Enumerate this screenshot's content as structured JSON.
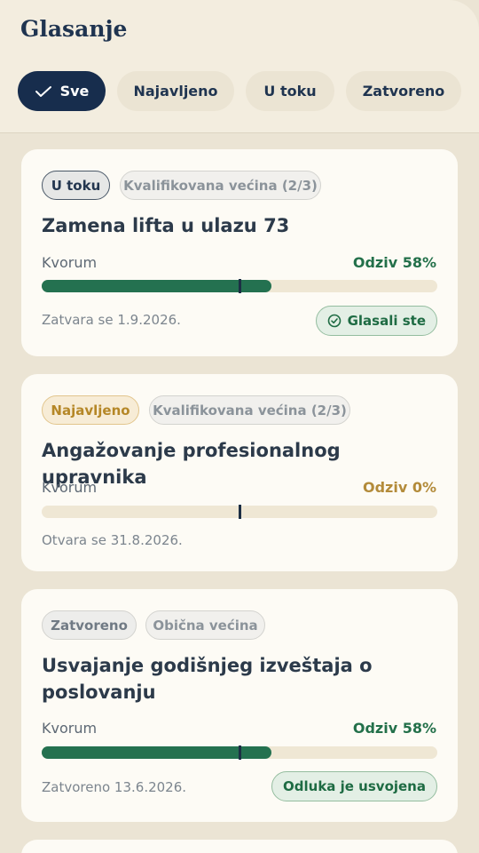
{
  "header": {
    "title": "Glasanje"
  },
  "filters": {
    "tabs": [
      {
        "label": "Sve",
        "active": true
      },
      {
        "label": "Najavljeno",
        "active": false
      },
      {
        "label": "U toku",
        "active": false
      },
      {
        "label": "Zatvoreno",
        "active": false
      }
    ]
  },
  "colors": {
    "accent": "#172d4d",
    "progress": "#247150",
    "scheduled": "#b58727",
    "background": "#ebe4d4"
  },
  "votes": [
    {
      "status": "U toku",
      "majority": "Kvalifikovana većina (2/3)",
      "title": "Zamena lifta u ulazu 73",
      "quorum_label": "Kvorum",
      "turnout_label": "Odziv 58%",
      "turnout_percent": 58,
      "quorum_percent": 50,
      "date": "Zatvara se 1.9.2026.",
      "badge": "Glasali ste",
      "badge_icon": "check-circle-icon"
    },
    {
      "status": "Najavljeno",
      "majority": "Kvalifikovana većina (2/3)",
      "title": "Angažovanje profesionalnog upravnika",
      "quorum_label": "Kvorum",
      "turnout_label": "Odziv 0%",
      "turnout_percent": 0,
      "quorum_percent": 50,
      "date": "Otvara se 31.8.2026."
    },
    {
      "status": "Zatvoreno",
      "majority": "Obična većina",
      "title": "Usvajanje godišnjeg izveštaja o poslovanju",
      "quorum_label": "Kvorum",
      "turnout_label": "Odziv 58%",
      "turnout_percent": 58,
      "quorum_percent": 50,
      "date": "Zatvoreno 13.6.2026.",
      "badge": "Odluka je usvojena"
    }
  ]
}
